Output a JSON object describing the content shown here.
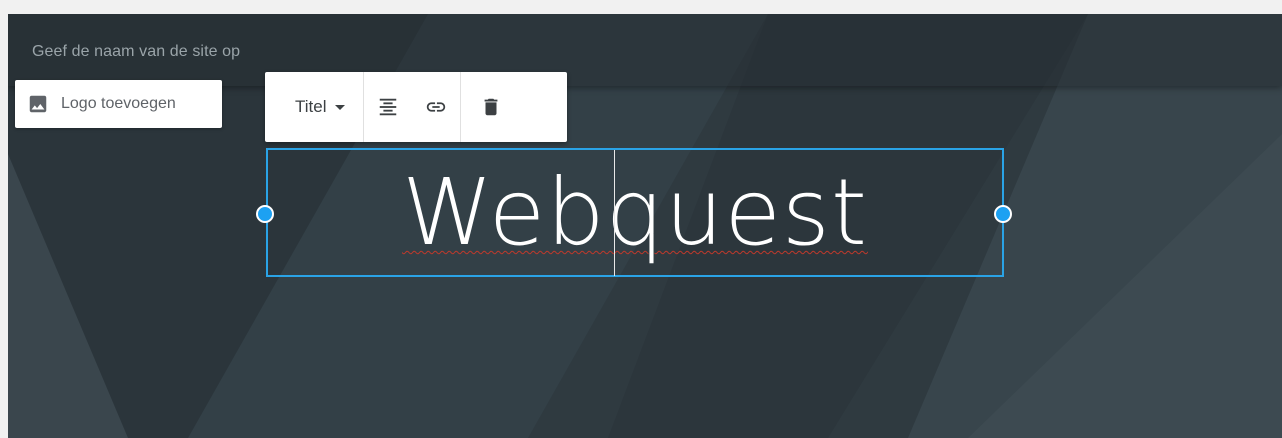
{
  "header": {
    "site_name_placeholder": "Geef de naam van de site op"
  },
  "logo_button": {
    "label": "Logo toevoegen",
    "icon": "image-icon"
  },
  "toolbar": {
    "style_select": "Titel",
    "icons": [
      "chevron-down-icon",
      "align-center-icon",
      "link-icon",
      "trash-icon"
    ]
  },
  "title": {
    "text": "Webquest"
  },
  "colors": {
    "background": "#2f3a40",
    "selection": "#2aa3e6",
    "handle": "#1da1f2",
    "spellcheck": "#c0392b"
  }
}
